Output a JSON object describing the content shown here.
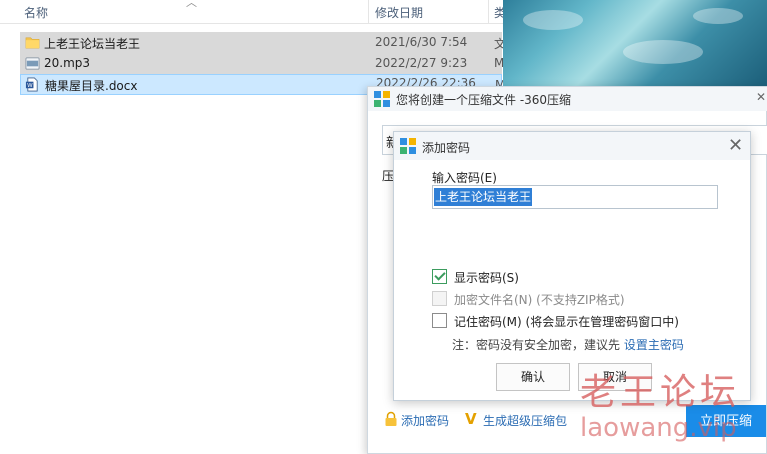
{
  "explorer": {
    "columns": {
      "name": "名称",
      "modified": "修改日期",
      "type_partial": "类"
    },
    "files": [
      {
        "name": "上老王论坛当老王",
        "modified": "2021/6/30 7:54",
        "type_partial": "文",
        "icon": "folder-icon"
      },
      {
        "name": "20.mp3",
        "modified": "2022/2/27 9:23",
        "type_partial": "M",
        "icon": "mp3-file-icon"
      },
      {
        "name": "糖果屋目录.docx",
        "modified": "2022/2/26 22:36",
        "type_partial": "M",
        "icon": "word-doc-icon"
      }
    ]
  },
  "zip_dialog": {
    "title": "您将创建一个压缩文件 -360压缩",
    "field_char": "新",
    "label_char": "压",
    "add_password_link": "添加密码",
    "super_zip_link": "生成超级压缩包",
    "compress_button": "立即压缩"
  },
  "password_dialog": {
    "title": "添加密码",
    "input_label": "输入密码(E)",
    "input_value": "上老王论坛当老王",
    "show_password": {
      "label": "显示密码(S)",
      "checked": true
    },
    "encrypt_filenames": {
      "label": "加密文件名(N) (不支持ZIP格式)",
      "checked": false,
      "disabled": true
    },
    "remember_password": {
      "label": "记住密码(M) (将会显示在管理密码窗口中)",
      "checked": false
    },
    "note_text": "注：密码没有安全加密，建议先",
    "note_link": "设置主密码",
    "ok_button": "确认",
    "cancel_button": "取消"
  },
  "watermark": {
    "cn": "老王论坛",
    "en": "laowang.vip"
  },
  "colors": {
    "accent": "#1a8ce8",
    "link": "#2b6cb3",
    "selection": "#cce8ff",
    "checkbox_checked": "#3c9c5e",
    "watermark": "#d65c5c"
  }
}
